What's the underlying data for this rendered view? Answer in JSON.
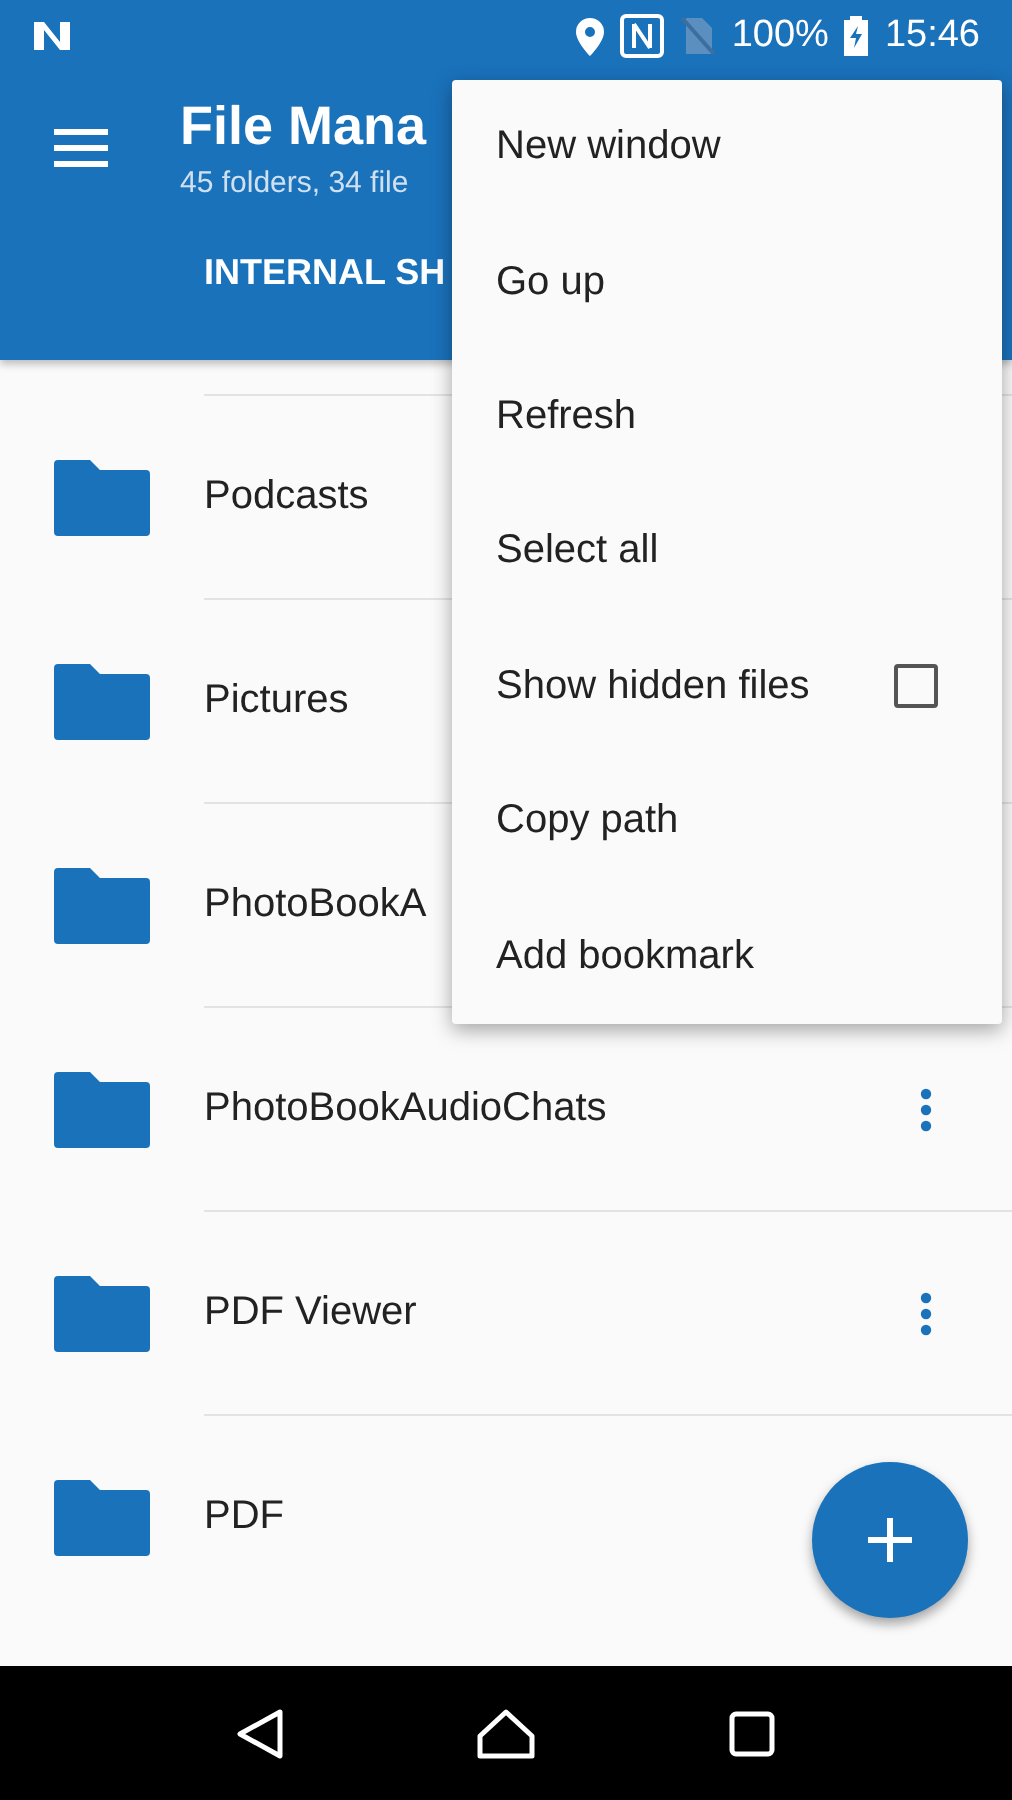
{
  "status_bar": {
    "battery": "100%",
    "time": "15:46"
  },
  "toolbar": {
    "title": "File Mana",
    "subtitle": "45 folders, 34 file",
    "tab": "INTERNAL SH"
  },
  "files": [
    {
      "name": "Podcasts",
      "more_button": false
    },
    {
      "name": "Pictures",
      "more_button": false
    },
    {
      "name": "PhotoBookA",
      "more_button": false
    },
    {
      "name": "PhotoBookAudioChats",
      "more_button": true
    },
    {
      "name": "PDF Viewer",
      "more_button": true
    },
    {
      "name": "PDF",
      "more_button": false
    }
  ],
  "menu": [
    {
      "label": "New window",
      "kind": "plain"
    },
    {
      "label": "Go up",
      "kind": "plain"
    },
    {
      "label": "Refresh",
      "kind": "plain"
    },
    {
      "label": "Select all",
      "kind": "plain"
    },
    {
      "label": "Show hidden files",
      "kind": "checkbox",
      "checked": false
    },
    {
      "label": "Copy path",
      "kind": "plain"
    },
    {
      "label": "Add bookmark",
      "kind": "plain"
    }
  ]
}
